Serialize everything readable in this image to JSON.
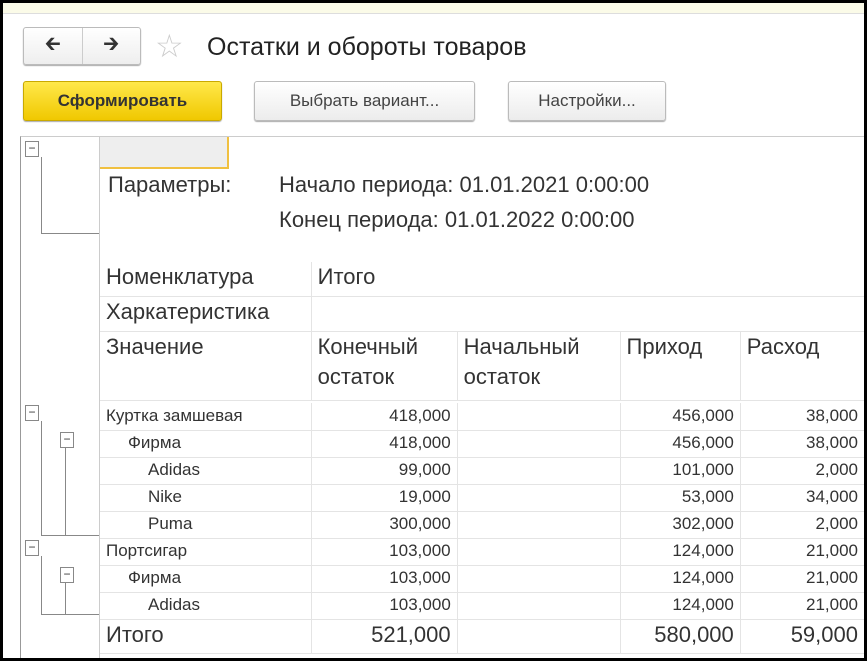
{
  "header": {
    "title": "Остатки и обороты товаров",
    "back_icon": "arrow-left",
    "forward_icon": "arrow-right",
    "favorite_icon": "star"
  },
  "toolbar": {
    "generate": "Сформировать",
    "choose_variant": "Выбрать вариант...",
    "settings": "Настройки..."
  },
  "params": {
    "label": "Параметры:",
    "start": "Начало периода: 01.01.2021 0:00:00",
    "end": "Конец периода: 01.01.2022 0:00:00"
  },
  "table": {
    "group_headers": {
      "nomenclature": "Номенклатура",
      "characteristic": "Харкатеристика",
      "value": "Значение",
      "total_group": "Итого"
    },
    "columns": [
      "Конечный остаток",
      "Начальный остаток",
      "Приход",
      "Расход"
    ],
    "rows": [
      {
        "name": "Куртка замшевая",
        "end": "418,000",
        "start": "",
        "in": "456,000",
        "out": "38,000"
      },
      {
        "name": "Фирма",
        "end": "418,000",
        "start": "",
        "in": "456,000",
        "out": "38,000"
      },
      {
        "name": "Adidas",
        "end": "99,000",
        "start": "",
        "in": "101,000",
        "out": "2,000"
      },
      {
        "name": "Nike",
        "end": "19,000",
        "start": "",
        "in": "53,000",
        "out": "34,000"
      },
      {
        "name": "Puma",
        "end": "300,000",
        "start": "",
        "in": "302,000",
        "out": "2,000"
      },
      {
        "name": "Портсигар",
        "end": "103,000",
        "start": "",
        "in": "124,000",
        "out": "21,000"
      },
      {
        "name": "Фирма",
        "end": "103,000",
        "start": "",
        "in": "124,000",
        "out": "21,000"
      },
      {
        "name": "Adidas",
        "end": "103,000",
        "start": "",
        "in": "124,000",
        "out": "21,000"
      }
    ],
    "total": {
      "name": "Итого",
      "end": "521,000",
      "start": "",
      "in": "580,000",
      "out": "59,000"
    }
  }
}
